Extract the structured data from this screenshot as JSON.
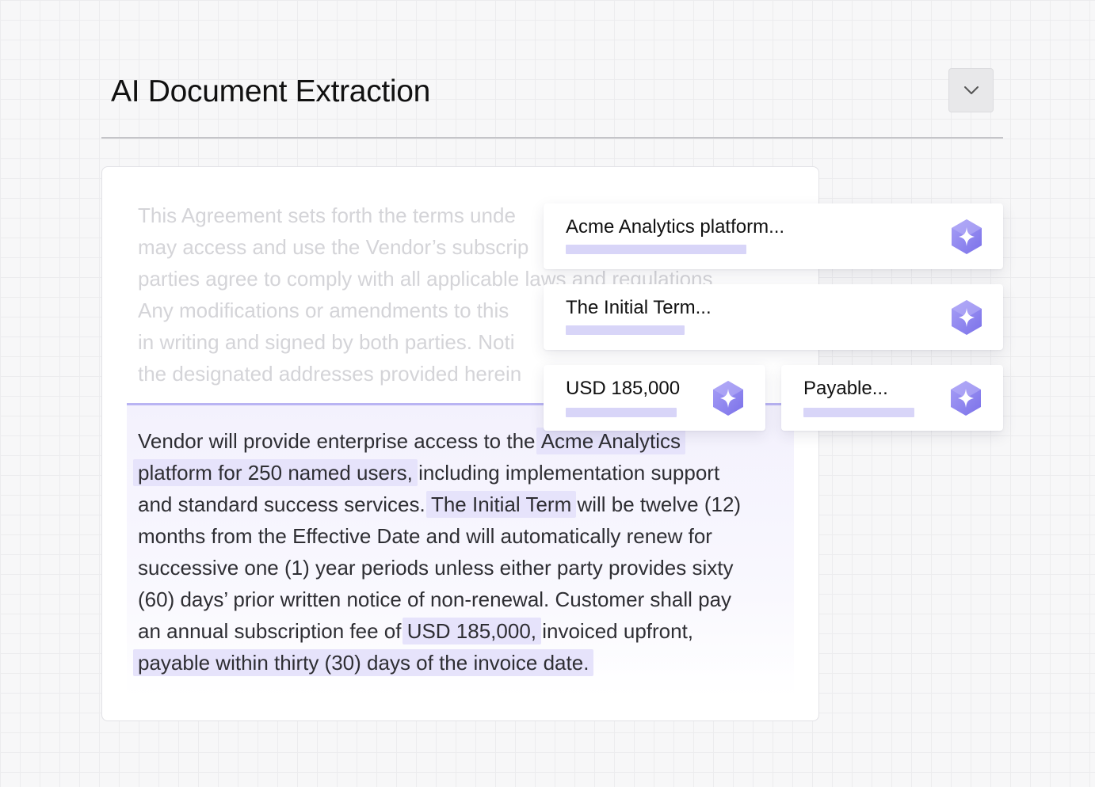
{
  "header": {
    "title": "AI Document Extraction"
  },
  "icons": {
    "dropdown": "chevron-down-icon",
    "extract": "sparkle-hexagon-icon"
  },
  "colors": {
    "accent": "#8f87f0",
    "highlight": "#e6e3fb",
    "bar": "#d8d5f8",
    "faded_text": "#d4d4d8"
  },
  "document": {
    "faded_lines": [
      "This Agreement sets forth the terms unde",
      "may access and use the Vendor’s subscrip",
      "parties agree to comply with all applicable laws and regulations",
      "Any modifications or amendments to this",
      "in writing and signed by both parties. Noti",
      "the designated addresses provided herein"
    ],
    "body": {
      "l1_a": "Vendor will provide enterprise access to the ",
      "l1_hl": "Acme Analytics",
      "l2_hl": "platform for 250 named users,",
      "l2_b": " including implementation support",
      "l3_a": "and standard success services. ",
      "l3_hl": "The Initial Term",
      "l3_b": " will be twelve (12)",
      "l4": "months from the Effective Date and will automatically renew for",
      "l5": "successive one (1) year periods unless either party provides sixty",
      "l6": "(60) days’ prior written notice of non-renewal. Customer shall pay",
      "l7_a": "an annual subscription fee of ",
      "l7_hl": "USD 185,000,",
      "l7_b": " invoiced upfront,",
      "l8_hl": "payable within thirty (30) days of the invoice date."
    }
  },
  "extractions": [
    {
      "label": "Acme Analytics platform..."
    },
    {
      "label": "The Initial Term..."
    },
    {
      "label": "USD 185,000"
    },
    {
      "label": "Payable..."
    }
  ]
}
